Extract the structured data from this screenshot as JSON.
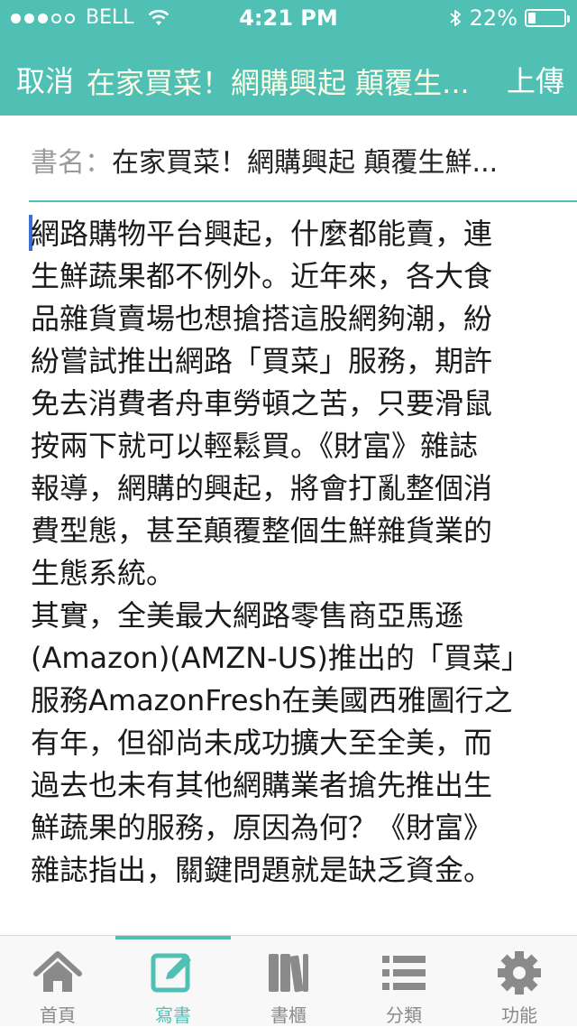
{
  "status": {
    "carrier": "BELL",
    "time": "4:21 PM",
    "battery": "22%",
    "signal_filled": 3,
    "signal_total": 5,
    "battery_level_fraction": 0.22
  },
  "nav": {
    "cancel_label": "取消",
    "title": "在家買菜！網購興起 顛覆生...",
    "upload_label": "上傳"
  },
  "book": {
    "label": "書名：",
    "value": "在家買菜！網購興起 顛覆生鮮..."
  },
  "content": {
    "text": "網路購物平台興起，什麼都能賣，連\n生鮮蔬果都不例外。近年來，各大食\n品雜貨賣場也想搶搭這股網夠潮，紛\n紛嘗試推出網路「買菜」服務，期許\n免去消費者舟車勞頓之苦，只要滑鼠\n按兩下就可以輕鬆買。《財富》雜誌\n報導，網購的興起，將會打亂整個消\n費型態，甚至顛覆整個生鮮雜貨業的\n生態系統。\n其實，全美最大網路零售商亞馬遜\n(Amazon)(AMZN-US)推出的「買菜」\n服務AmazonFresh在美國西雅圖行之\n有年，但卻尚未成功擴大至全美，而\n過去也未有其他網購業者搶先推出生\n鮮蔬果的服務，原因為何？《財富》\n雜誌指出，關鍵問題就是缺乏資金。"
  },
  "tabs": [
    {
      "label": "首頁",
      "icon": "home-icon",
      "active": false
    },
    {
      "label": "寫書",
      "icon": "compose-icon",
      "active": true
    },
    {
      "label": "書櫃",
      "icon": "bookshelf-icon",
      "active": false
    },
    {
      "label": "分類",
      "icon": "list-icon",
      "active": false
    },
    {
      "label": "功能",
      "icon": "gear-icon",
      "active": false
    }
  ],
  "colors": {
    "accent": "#4fc0b3",
    "title_text": "#fffce6",
    "tab_inactive": "#8a8a8a"
  }
}
